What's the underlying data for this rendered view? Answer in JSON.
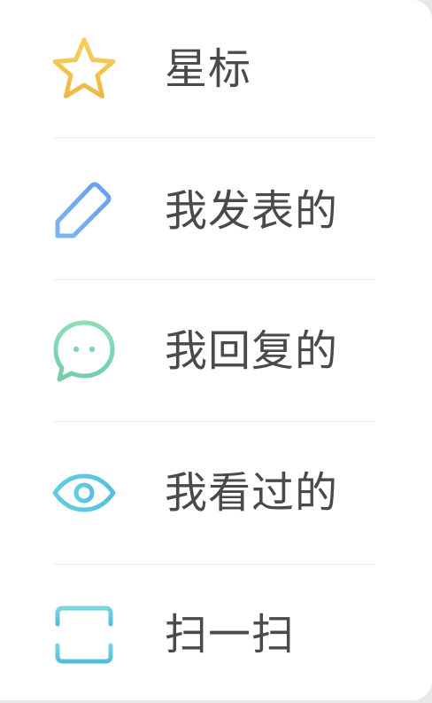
{
  "menu": {
    "items": [
      {
        "label": "星标",
        "icon": "star-icon"
      },
      {
        "label": "我发表的",
        "icon": "pencil-icon"
      },
      {
        "label": "我回复的",
        "icon": "chat-bubble-icon"
      },
      {
        "label": "我看过的",
        "icon": "eye-icon"
      },
      {
        "label": "扫一扫",
        "icon": "scan-icon"
      }
    ]
  },
  "colors": {
    "star": "#F2C14E",
    "pencil": "#6FA8F0",
    "chat": "#7FD6B0",
    "eye": "#5CC8E0",
    "scan": "#5CC8E0",
    "label_text": "#4A4A4A",
    "divider": "#ECECEC"
  }
}
